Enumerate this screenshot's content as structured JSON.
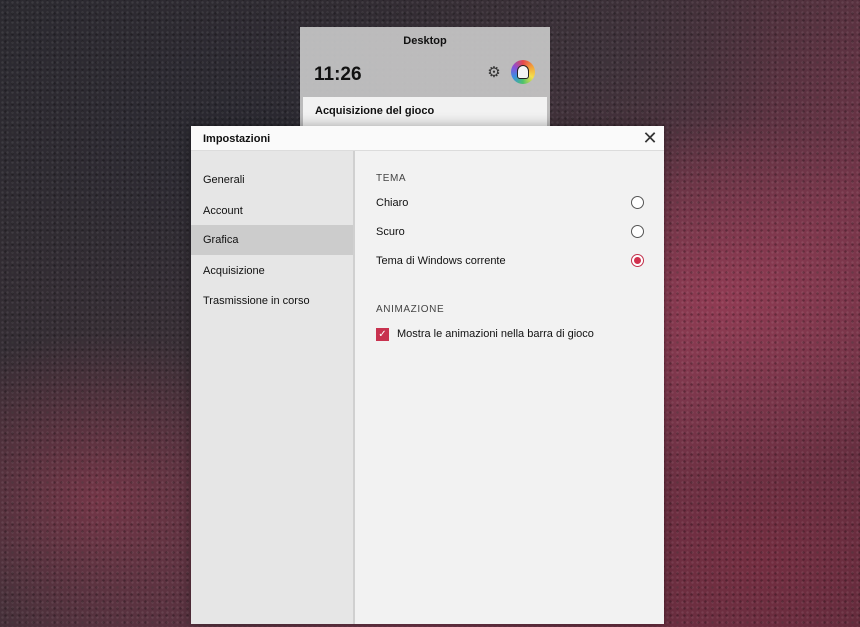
{
  "gamebar": {
    "title": "Desktop",
    "time": "11:26",
    "capture_section": "Acquisizione del gioco",
    "gear_icon": "⚙"
  },
  "dialog": {
    "title": "Impostazioni",
    "close_icon": "✕"
  },
  "sidebar": {
    "items": [
      {
        "label": "Generali"
      },
      {
        "label": "Account"
      },
      {
        "label": "Grafica"
      },
      {
        "label": "Acquisizione"
      },
      {
        "label": "Trasmissione in corso"
      }
    ],
    "active": "Grafica"
  },
  "theme": {
    "section_title": "TEMA",
    "options": [
      {
        "label": "Chiaro",
        "checked": false
      },
      {
        "label": "Scuro",
        "checked": false
      },
      {
        "label": "Tema di Windows corrente",
        "checked": true
      }
    ]
  },
  "animation": {
    "section_title": "ANIMAZIONE",
    "checkbox_label": "Mostra le animazioni nella barra di gioco",
    "checked": true,
    "check_glyph": "✓"
  },
  "colors": {
    "accent": "#d1304d"
  }
}
